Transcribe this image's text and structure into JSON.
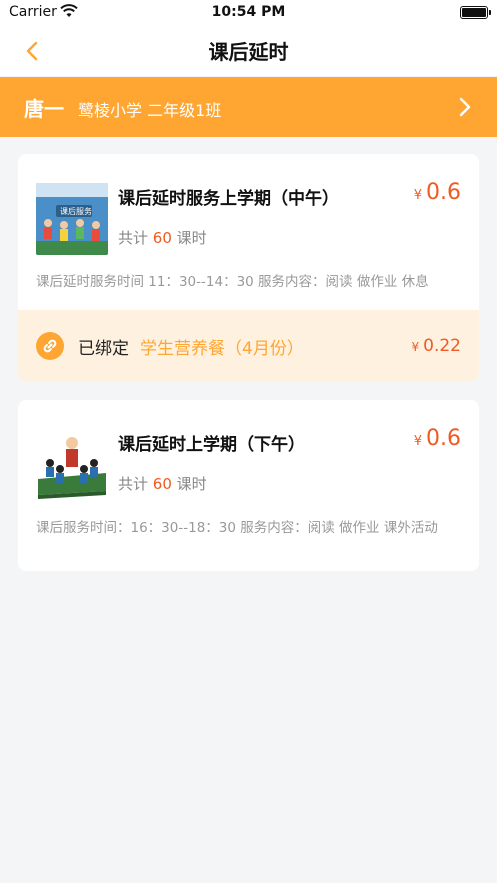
{
  "status_bar": {
    "carrier": "Carrier",
    "time": "10:54 PM"
  },
  "nav": {
    "title": "课后延时"
  },
  "student": {
    "name": "唐一",
    "school_class": "鹭棱小学 二年级1班"
  },
  "courses": [
    {
      "title": "课后延时服务上学期（中午）",
      "currency": "¥",
      "price": "0.6",
      "hours_prefix": "共计",
      "hours": "60",
      "hours_suffix": "课时",
      "description": "课后延时服务时间 11：30--14：30  服务内容：阅读  做作业  休息",
      "thumb_caption": "课后服务",
      "binding": {
        "label": "已绑定",
        "meal": "学生营养餐（4月份）",
        "currency": "¥",
        "price": "0.22"
      }
    },
    {
      "title": "课后延时上学期（下午）",
      "currency": "¥",
      "price": "0.6",
      "hours_prefix": "共计",
      "hours": "60",
      "hours_suffix": "课时",
      "description": "课后服务时间：16：30--18：30  服务内容：阅读  做作业  课外活动"
    }
  ],
  "colors": {
    "accent": "#ffa632",
    "price": "#f05a23",
    "bind_bg": "#fff1e0"
  }
}
